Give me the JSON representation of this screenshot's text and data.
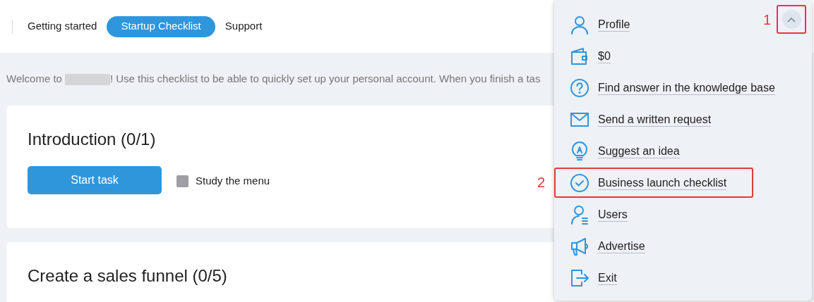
{
  "tabs": [
    {
      "label": "Getting started",
      "selected": false
    },
    {
      "label": "Startup Checklist",
      "selected": true
    },
    {
      "label": "Support",
      "selected": false
    }
  ],
  "welcome": {
    "before": "Welcome to",
    "after": "! Use this checklist to be able to quickly set up your personal account. When you finish a tas"
  },
  "sections": [
    {
      "title": "Introduction (0/1)",
      "button": "Start task",
      "tasks": [
        {
          "label": "Study the menu",
          "checked": false
        }
      ]
    },
    {
      "title": "Create a sales funnel (0/5)"
    }
  ],
  "menu": {
    "toggle": {
      "annotation": "1"
    },
    "items": [
      {
        "label": "Profile"
      },
      {
        "label": "$0"
      },
      {
        "label": "Find answer in the knowledge base"
      },
      {
        "label": "Send a written request"
      },
      {
        "label": "Suggest an idea"
      },
      {
        "label": "Business launch checklist",
        "annotation": "2"
      },
      {
        "label": "Users"
      },
      {
        "label": "Advertise"
      },
      {
        "label": "Exit"
      }
    ]
  }
}
